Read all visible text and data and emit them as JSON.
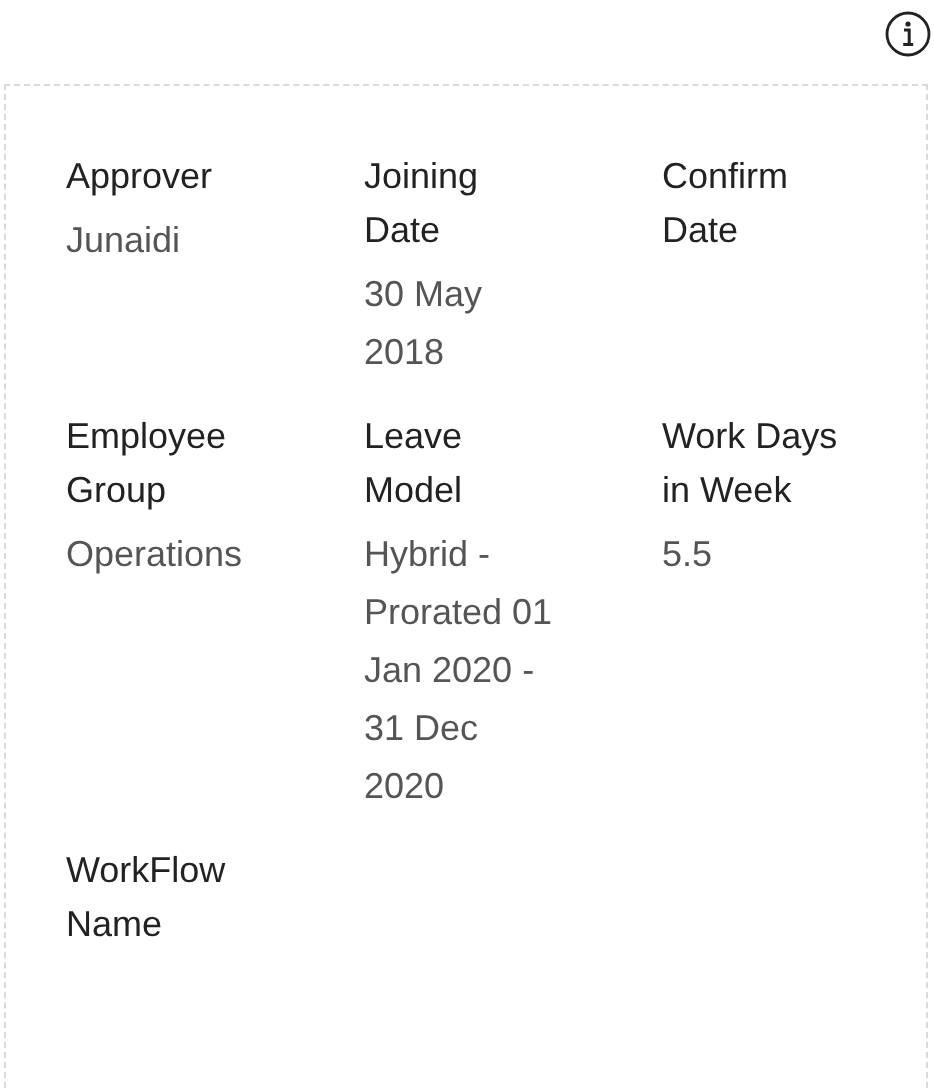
{
  "fields": [
    {
      "label": "Approver",
      "value": "Junaidi"
    },
    {
      "label": "Joining Date",
      "value": "30 May 2018"
    },
    {
      "label": "Confirm Date"
    },
    {
      "label": "Employee Group",
      "value": "Operations"
    },
    {
      "label": "Leave Model",
      "value": "Hybrid - Prorated 01 Jan 2020 - 31 Dec 2020"
    },
    {
      "label": "Work Days in Week",
      "value": "5.5"
    },
    {
      "label": "WorkFlow Name"
    }
  ]
}
